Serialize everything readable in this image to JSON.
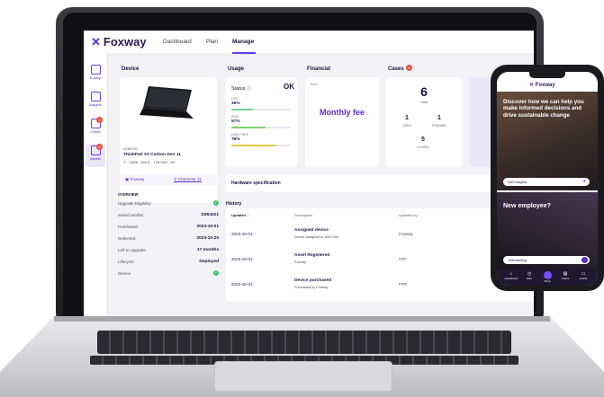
{
  "app": {
    "brand": "Foxway"
  },
  "nav": {
    "dashboard": "Dashboard",
    "plan": "Plan",
    "manage": "Manage"
  },
  "sidebar": {
    "items": [
      {
        "label": "E-shop"
      },
      {
        "label": "Insights"
      },
      {
        "label": "Cases",
        "badge": "1"
      },
      {
        "label": "Assets",
        "badge": "6"
      }
    ]
  },
  "device": {
    "title": "Device",
    "model_small": "LENOVO",
    "model": "ThinkPad X1 Carbon Gen 11",
    "spec": "i7 - 16GB - Win11 - 1TB SSD - MT",
    "owner": "Foxway",
    "character": "Character 11",
    "overview_title": "OVERVIEW",
    "rows": [
      {
        "label": "Upgrade Eligibility",
        "value": ""
      },
      {
        "label": "Serial number",
        "value": "D654321"
      },
      {
        "label": "Purchased",
        "value": "2023-10-01"
      },
      {
        "label": "Delivered",
        "value": "2023-10-20"
      },
      {
        "label": "Left to upgrade",
        "value": "17 months"
      },
      {
        "label": "Lifecycle",
        "value": "Deployed"
      },
      {
        "label": "Device",
        "value": ""
      }
    ]
  },
  "usage": {
    "title": "Usage",
    "status_label": "Status",
    "status_value": "OK",
    "metrics": [
      {
        "label": "CPU",
        "value": "36%",
        "fraction": 0.36
      },
      {
        "label": "RAM",
        "value": "57%",
        "fraction": 0.57
      },
      {
        "label": "DISK FREE",
        "value": "76%",
        "fraction": 0.76
      }
    ]
  },
  "financial": {
    "title": "Financial",
    "small": "Rent",
    "main": "Monthly fee"
  },
  "cases": {
    "title": "Cases",
    "badge": "6",
    "total_value": "6",
    "total_label": "Total",
    "open_value": "1",
    "open_label": "OPEN",
    "pending_value": "1",
    "pending_label": "PENDING",
    "closed_value": "5",
    "closed_label": "CLOSED"
  },
  "hardware": {
    "title": "Hardware specification"
  },
  "history": {
    "title": "History",
    "columns": [
      "Updated",
      "Description",
      "Updated by"
    ],
    "rows": [
      {
        "date": "2023-10-01",
        "title": "Assigned device",
        "sub": "Device assigned to John Doe",
        "by": "Foxway"
      },
      {
        "date": "2023-10-01",
        "title": "Asset Registered",
        "sub": "Foxway",
        "by": "CFF"
      },
      {
        "date": "2023-10-01",
        "title": "Device purchased",
        "sub": "Purchased by Foxway",
        "by": "FPP"
      }
    ]
  },
  "phone": {
    "brand": "Foxway",
    "headline": "Discover how we can help you make informed decisions and drive sustainable change",
    "insights_btn": "Get insights",
    "employee_title": "New employee?",
    "onboarding_btn": "Onboarding",
    "tabs": [
      "Dashboard",
      "Plan",
      "Shop",
      "Cases",
      "Assets"
    ]
  },
  "colors": {
    "accent": "#6a3be8",
    "brand_dark": "#2b1a55",
    "ok_green": "#27b35b"
  }
}
